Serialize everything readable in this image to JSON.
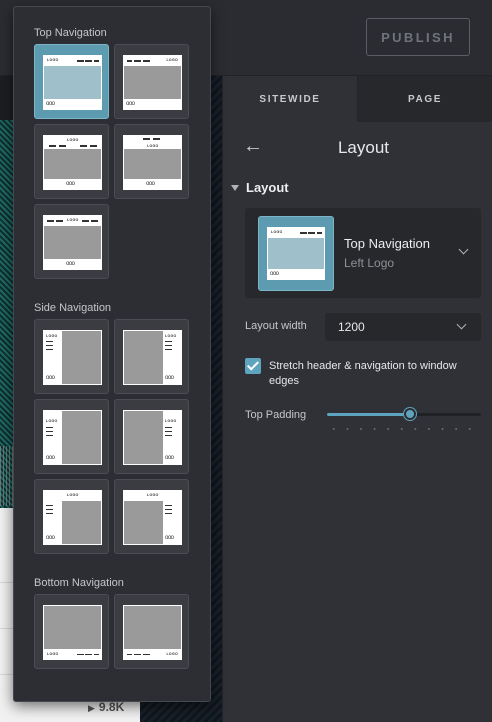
{
  "header": {
    "publish_label": "PUBLISH"
  },
  "background": {
    "stat_value": "9.8K"
  },
  "panel": {
    "tabs": [
      {
        "label": "SITEWIDE",
        "active": true
      },
      {
        "label": "PAGE",
        "active": false
      }
    ],
    "title": "Layout",
    "section_label": "Layout",
    "selected_layout": {
      "title": "Top Navigation",
      "subtitle": "Left Logo"
    },
    "layout_width": {
      "label": "Layout width",
      "value": "1200"
    },
    "stretch": {
      "label": "Stretch header & navigation to window edges",
      "checked": true
    },
    "top_padding": {
      "label": "Top Padding",
      "value_fraction": 0.54
    }
  },
  "popover": {
    "groups": [
      {
        "label": "Top Navigation",
        "options": [
          "top-left-logo",
          "top-right-logo",
          "top-center-logo-below",
          "top-center-logo-above",
          "top-center-logo-inline"
        ]
      },
      {
        "label": "Side Navigation",
        "options": [
          "side-left-logo-top",
          "side-right-logo-top",
          "side-left-logo-mid",
          "side-right-logo-mid",
          "side-left-header",
          "side-right-header"
        ]
      },
      {
        "label": "Bottom Navigation",
        "options": [
          "bottom-left-logo",
          "bottom-right-logo"
        ]
      }
    ],
    "logo_text": "LOGO",
    "dots_text": "ooo"
  },
  "colors": {
    "accent": "#5fa4be",
    "selected_tile": "#5d9bb1",
    "panel_bg": "#2f3136"
  }
}
